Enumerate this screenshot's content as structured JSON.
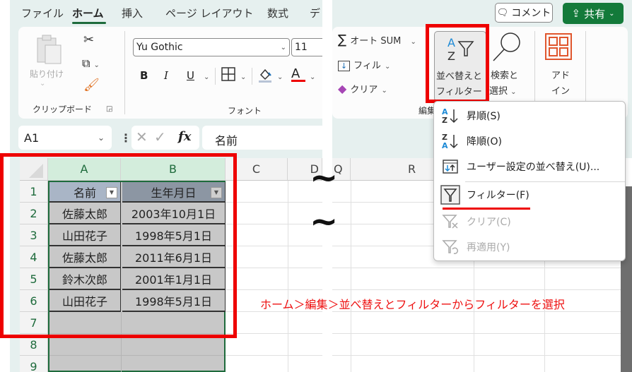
{
  "tabs": [
    {
      "label": "ファイル",
      "active": false
    },
    {
      "label": "ホーム",
      "active": true
    },
    {
      "label": "挿入",
      "active": false
    },
    {
      "label": "ページ レイアウト",
      "active": false
    },
    {
      "label": "数式",
      "active": false
    },
    {
      "label": "デ",
      "active": false
    }
  ],
  "top_buttons": {
    "comment": "コメント",
    "share": "共有"
  },
  "clipboard": {
    "paste": "貼り付け",
    "group_label": "クリップボード"
  },
  "font": {
    "name": "Yu Gothic",
    "size": "11",
    "bold": "B",
    "italic": "I",
    "underline": "U",
    "font_color_letter": "A",
    "group_label": "フォント"
  },
  "editing": {
    "autosum": "オート SUM",
    "fill": "フィル",
    "clear": "クリア",
    "sort_filter_line1": "並べ替えと",
    "sort_filter_line2": "フィルター",
    "find_line1": "検索と",
    "find_line2": "選択",
    "addin_line1": "アド",
    "addin_line2": "イン",
    "group_label": "編集"
  },
  "formula_bar": {
    "name_box": "A1",
    "fx": "fx",
    "content": "名前"
  },
  "sheet": {
    "columns_left": [
      "A",
      "B",
      "C",
      "D"
    ],
    "columns_right": [
      "Q",
      "R"
    ],
    "rows": [
      "1",
      "2",
      "3",
      "4",
      "5",
      "6",
      "7",
      "8",
      "9"
    ],
    "headers": [
      "名前",
      "生年月日"
    ],
    "data": [
      [
        "佐藤太郎",
        "2003年10月1日"
      ],
      [
        "山田花子",
        "1998年5月1日"
      ],
      [
        "佐藤太郎",
        "2011年6月1日"
      ],
      [
        "鈴木次郎",
        "2001年1月1日"
      ],
      [
        "山田花子",
        "1998年5月1日"
      ]
    ]
  },
  "sort_menu": {
    "items": [
      {
        "label": "昇順(S)",
        "icon": "sort-ascending-icon",
        "enabled": true
      },
      {
        "label": "降順(O)",
        "icon": "sort-descending-icon",
        "enabled": true
      },
      {
        "label": "ユーザー設定の並べ替え(U)...",
        "icon": "custom-sort-icon",
        "enabled": true
      },
      {
        "label": "フィルター(F)",
        "icon": "filter-icon",
        "enabled": true
      },
      {
        "label": "クリア(C)",
        "icon": "clear-filter-icon",
        "enabled": false
      },
      {
        "label": "再適用(Y)",
        "icon": "reapply-filter-icon",
        "enabled": false
      }
    ]
  },
  "annotation": {
    "tilde": "~",
    "instruction": "ホーム＞編集＞並べ替えとフィルターからフィルターを選択",
    "highlight_color": "#ee0000"
  }
}
